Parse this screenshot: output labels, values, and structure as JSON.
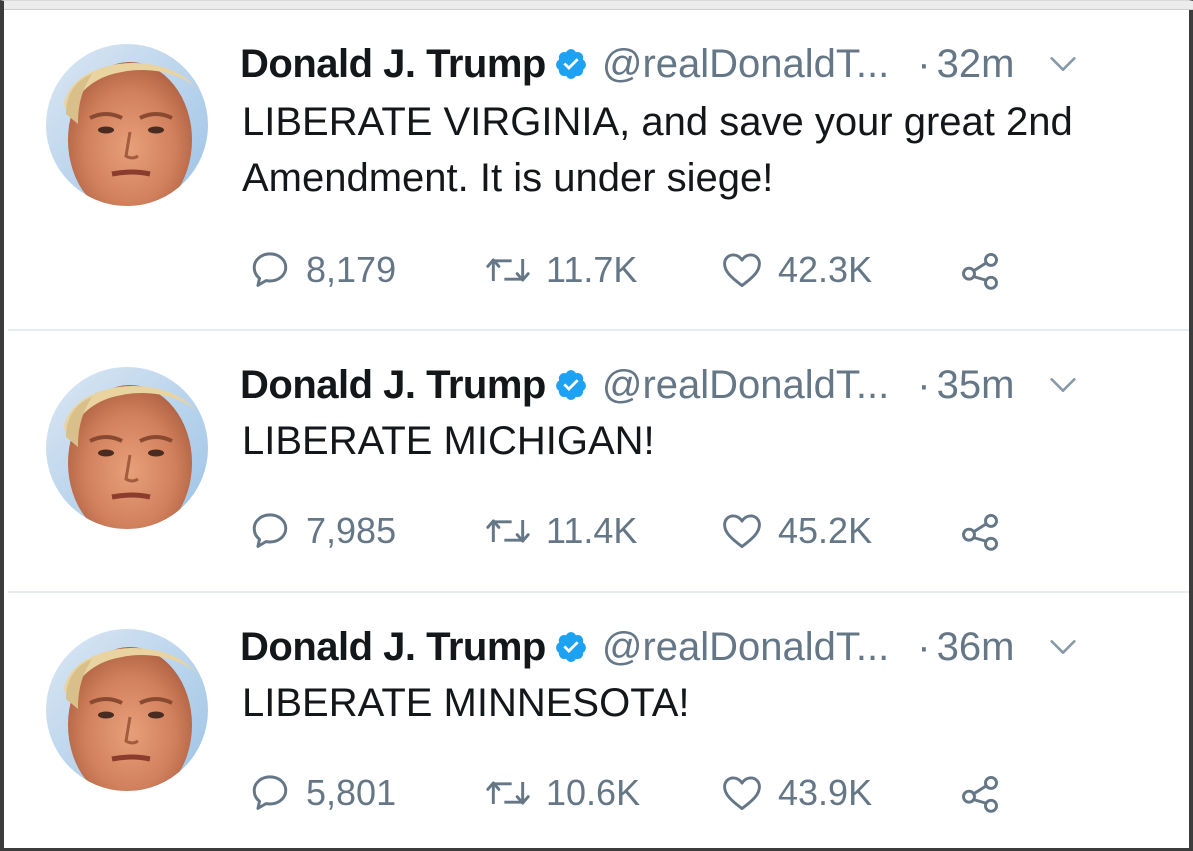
{
  "colors": {
    "text_primary": "#14171a",
    "text_secondary": "#657786",
    "verified_blue": "#1da1f2",
    "divider": "#e6ecf0"
  },
  "icons": {
    "verified": "verified-badge-icon",
    "caret": "chevron-down-icon",
    "reply": "reply-icon",
    "retweet": "retweet-icon",
    "like": "heart-icon",
    "share": "share-icon"
  },
  "tweets": [
    {
      "name": "Donald J. Trump",
      "handle": "@realDonaldT...",
      "separator": "·",
      "time": "32m",
      "text": "LIBERATE VIRGINIA, and save your great 2nd Amendment. It is under siege!",
      "replies": "8,179",
      "retweets": "11.7K",
      "likes": "42.3K"
    },
    {
      "name": "Donald J. Trump",
      "handle": "@realDonaldT...",
      "separator": "·",
      "time": "35m",
      "text": "LIBERATE MICHIGAN!",
      "replies": "7,985",
      "retweets": "11.4K",
      "likes": "45.2K"
    },
    {
      "name": "Donald J. Trump",
      "handle": "@realDonaldT...",
      "separator": "·",
      "time": "36m",
      "text": "LIBERATE MINNESOTA!",
      "replies": "5,801",
      "retweets": "10.6K",
      "likes": "43.9K"
    }
  ]
}
